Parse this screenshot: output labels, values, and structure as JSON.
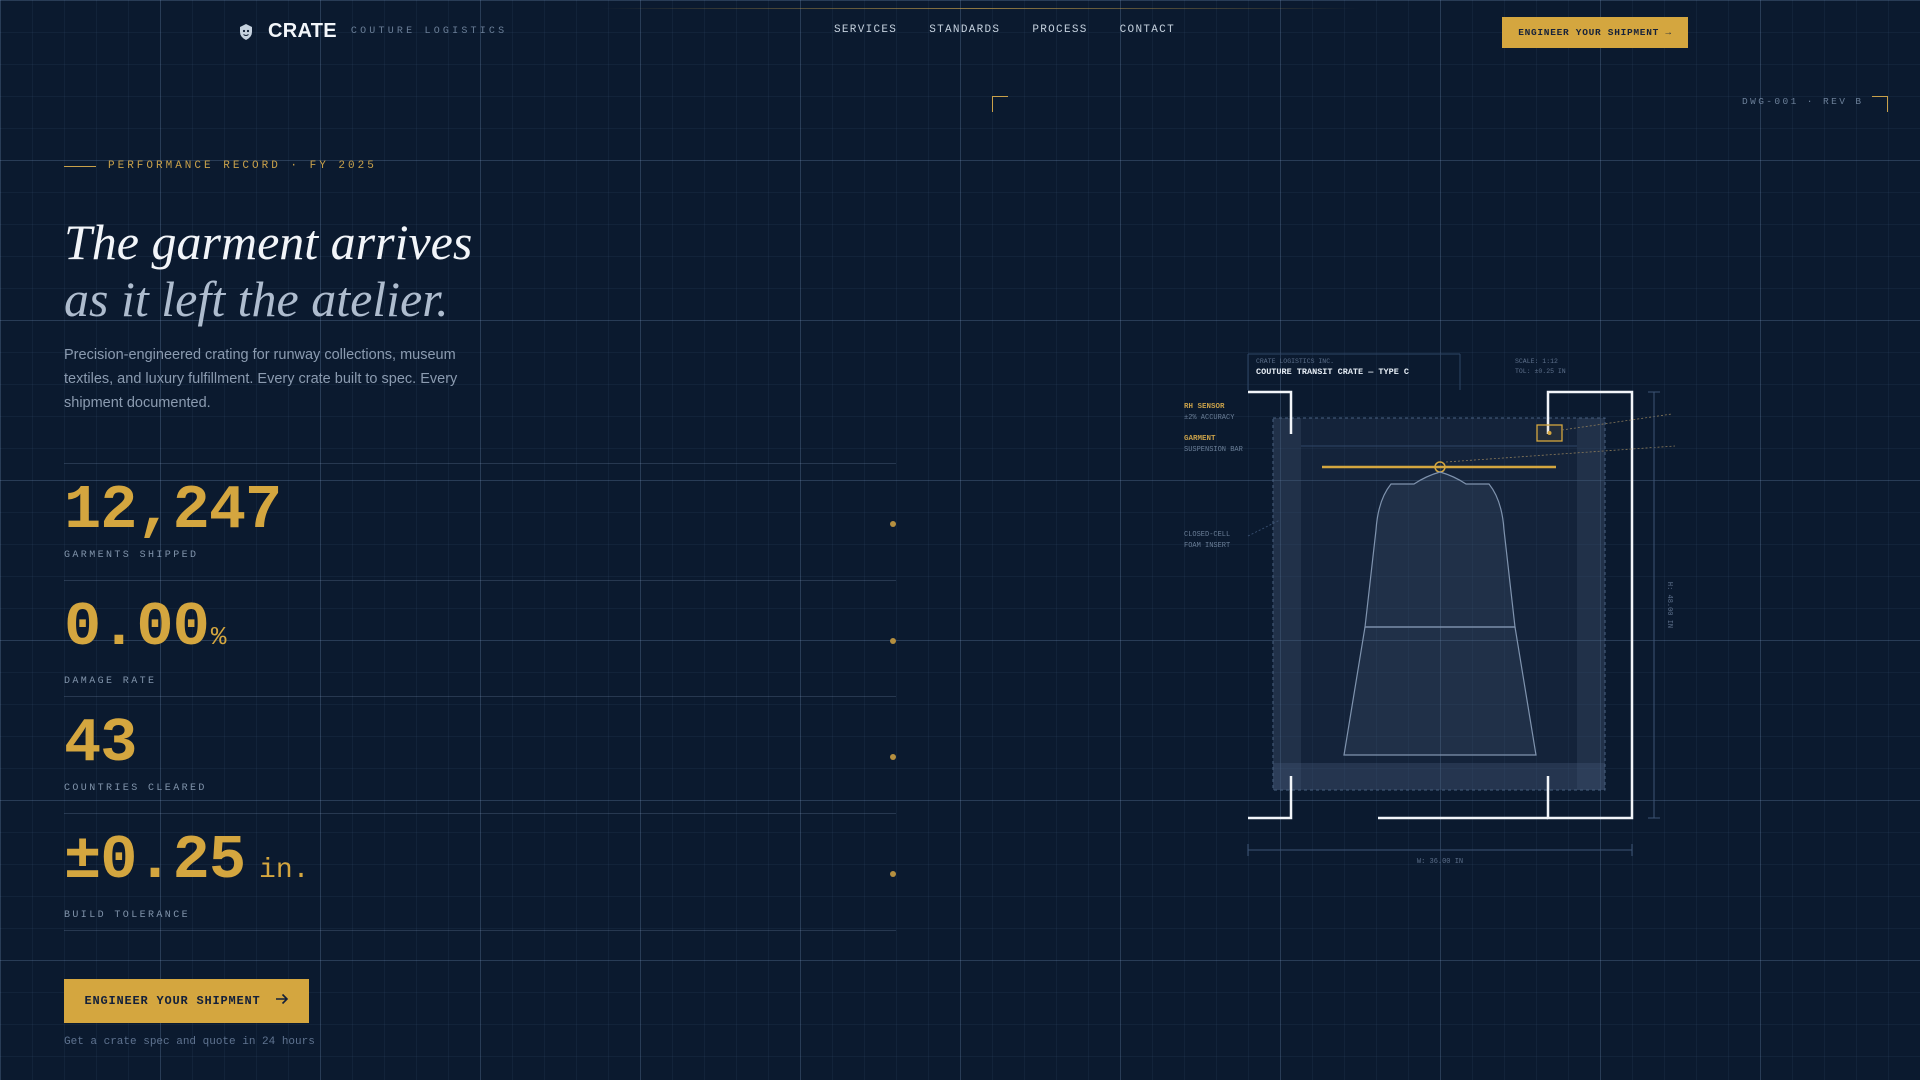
{
  "brand": {
    "name": "CRATE",
    "tagline": "COUTURE LOGISTICS"
  },
  "nav": {
    "items": [
      "SERVICES",
      "STANDARDS",
      "PROCESS",
      "CONTACT"
    ],
    "cta_label": "ENGINEER YOUR SHIPMENT →"
  },
  "drawing_code": "DWG-001 · REV B",
  "hero": {
    "eyebrow": "PERFORMANCE RECORD · FY 2025",
    "headline_line1": "The garment arrives",
    "headline_line2": "as it left the atelier.",
    "lede": "Precision-engineered crating for runway collections, museum textiles, and luxury fulfillment. Every crate built to spec. Every shipment documented."
  },
  "stats": [
    {
      "value": "12,247",
      "suffix": "",
      "label": "GARMENTS SHIPPED"
    },
    {
      "value": "0.00",
      "suffix": "%",
      "label": "DAMAGE RATE"
    },
    {
      "value": "43",
      "suffix": "",
      "label": "COUNTRIES CLEARED"
    },
    {
      "value": "±0.25",
      "suffix": "in.",
      "label": "BUILD TOLERANCE"
    }
  ],
  "cta": {
    "label": "ENGINEER YOUR SHIPMENT",
    "note": "Get a crate spec and quote in 24 hours"
  },
  "diagram": {
    "company": "CRATE LOGISTICS INC.",
    "title": "COUTURE TRANSIT CRATE — TYPE C",
    "scale": "SCALE: 1:12",
    "tolerance": "TOL: ±0.25 IN",
    "rh_sensor_title": "RH SENSOR",
    "rh_sensor_detail": "±2% ACCURACY",
    "garment_title": "GARMENT",
    "garment_detail": "SUSPENSION BAR",
    "foam_line1": "CLOSED-CELL",
    "foam_line2": "FOAM INSERT",
    "width_dim": "W: 36.00 IN",
    "height_dim": "H: 48.00 IN"
  },
  "colors": {
    "background": "#0b1a2f",
    "accent": "#d4a63f",
    "text_primary": "#f2f5f9",
    "text_muted": "#8b9bb0"
  }
}
